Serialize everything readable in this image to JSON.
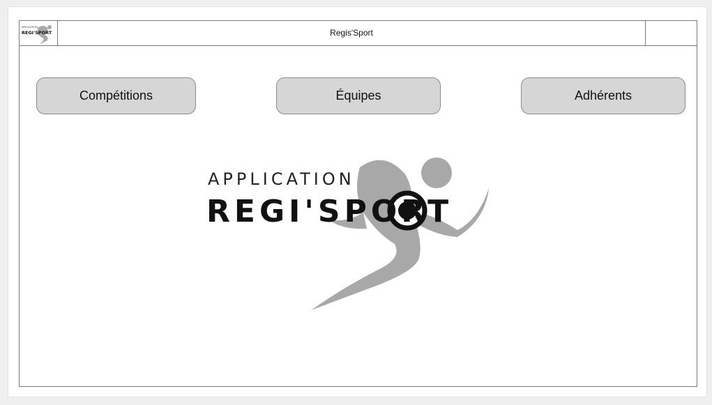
{
  "window": {
    "title": "Regis'Sport"
  },
  "nav": {
    "buttons": [
      {
        "label": "Compétitions"
      },
      {
        "label": "Équipes"
      },
      {
        "label": "Adhérents"
      }
    ]
  },
  "logo": {
    "line1": "APPLICATION",
    "line2": "REGI'SPORT",
    "small_line1": "APPLICATION",
    "small_line2": "REGI'SPORT",
    "runner_color": "#a8a8a8",
    "text_color": "#111111"
  }
}
